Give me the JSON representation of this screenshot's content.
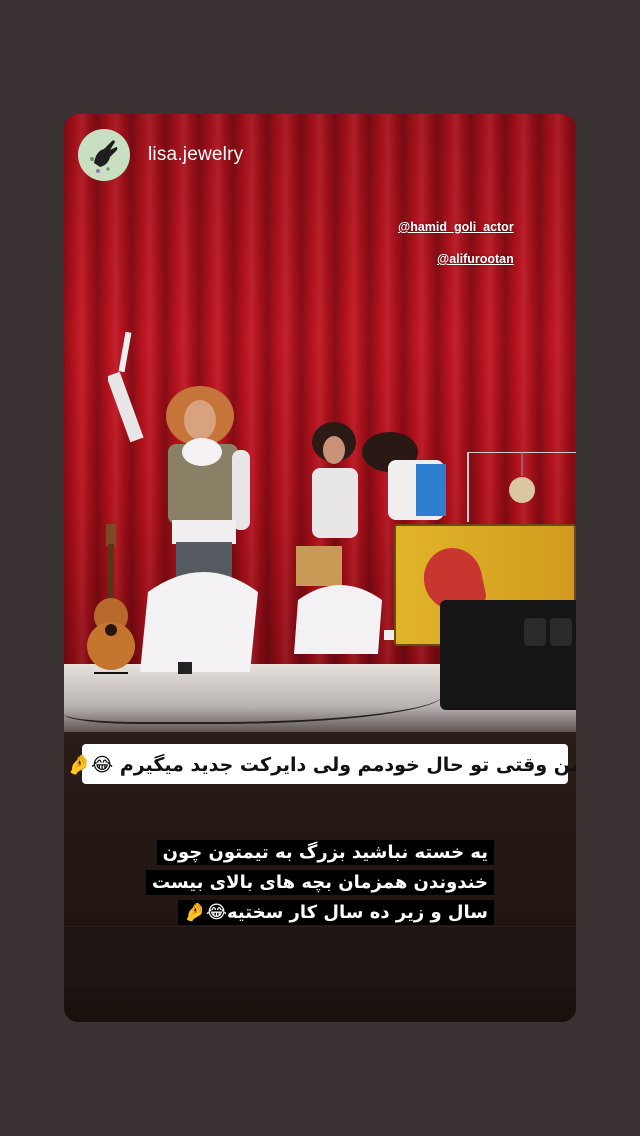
{
  "story": {
    "username": "lisa.jewelry",
    "avatar_icon": "hand-logo-icon",
    "mentions": [
      "@hamid_goli_actor",
      "@alifurootan"
    ],
    "caption_main": "من وقتی تو حال خودمم ولی دایرکت جدید میگیرم 😂🤌",
    "caption_second_lines": [
      "یه خسته نباشید بزرگ به تیمتون چون",
      "خندوندن همزمان بچه های بالای بیست",
      "سال و زیر ده سال کار سختیه😂🤌"
    ],
    "colors": {
      "background": "#3a3232",
      "curtain": "#c01420",
      "caption_bg": "#ffffff",
      "caption2_bg": "#000000"
    }
  }
}
